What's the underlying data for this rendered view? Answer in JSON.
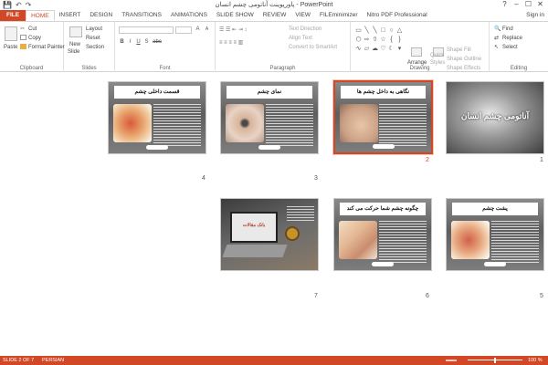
{
  "window": {
    "title": "پاورپوینت آناتومی چشم انسان - PowerPoint",
    "controls": [
      "?",
      "–",
      "☐",
      "✕"
    ]
  },
  "qat": {
    "icons": [
      "save-icon",
      "undo-icon",
      "redo-icon"
    ]
  },
  "tabs": [
    {
      "label": "FILE"
    },
    {
      "label": "HOME"
    },
    {
      "label": "INSERT"
    },
    {
      "label": "DESIGN"
    },
    {
      "label": "TRANSITIONS"
    },
    {
      "label": "ANIMATIONS"
    },
    {
      "label": "SLIDE SHOW"
    },
    {
      "label": "REVIEW"
    },
    {
      "label": "VIEW"
    },
    {
      "label": "FILEminimizer"
    },
    {
      "label": "Nitro PDF Professional"
    }
  ],
  "signin": "Sign in",
  "ribbon": {
    "clipboard": {
      "paste": "Paste",
      "cut": "Cut",
      "copy": "Copy",
      "format_painter": "Format Painter",
      "label": "Clipboard"
    },
    "slides": {
      "new_slide": "New",
      "new_slide2": "Slide",
      "layout": "Layout",
      "reset": "Reset",
      "section": "Section",
      "label": "Slides"
    },
    "font": {
      "label": "Font",
      "bold": "B",
      "italic": "I",
      "underline": "U",
      "shadow": "S",
      "strike": "abc",
      "size_up": "A",
      "size_down": "A"
    },
    "paragraph": {
      "text_direction": "Text Direction",
      "align_text": "Align Text",
      "smartart": "Convert to SmartArt",
      "label": "Paragraph"
    },
    "drawing": {
      "arrange": "Arrange",
      "quick_styles": "Quick",
      "quick_styles2": "Styles",
      "shape_fill": "Shape Fill",
      "shape_outline": "Shape Outline",
      "shape_effects": "Shape Effects",
      "label": "Drawing"
    },
    "editing": {
      "find": "Find",
      "replace": "Replace",
      "select": "Select",
      "label": "Editing"
    }
  },
  "slides": [
    {
      "num": "1",
      "title": "آناتومی چشم انسان"
    },
    {
      "num": "2",
      "title": "نگاهی به داخل چشم ها"
    },
    {
      "num": "3",
      "title": "نمای چشم"
    },
    {
      "num": "4",
      "title": "قسمت داخلی چشم"
    },
    {
      "num": "5",
      "title": "پشت چشم"
    },
    {
      "num": "6",
      "title": "چگونه چشم شما حرکت می کند"
    },
    {
      "num": "7",
      "title": "بانک مقالات"
    }
  ],
  "status": {
    "slide": "SLIDE 2 OF 7",
    "language": "PERSIAN",
    "zoom": "100 %"
  },
  "colors": {
    "accent": "#d24726"
  }
}
